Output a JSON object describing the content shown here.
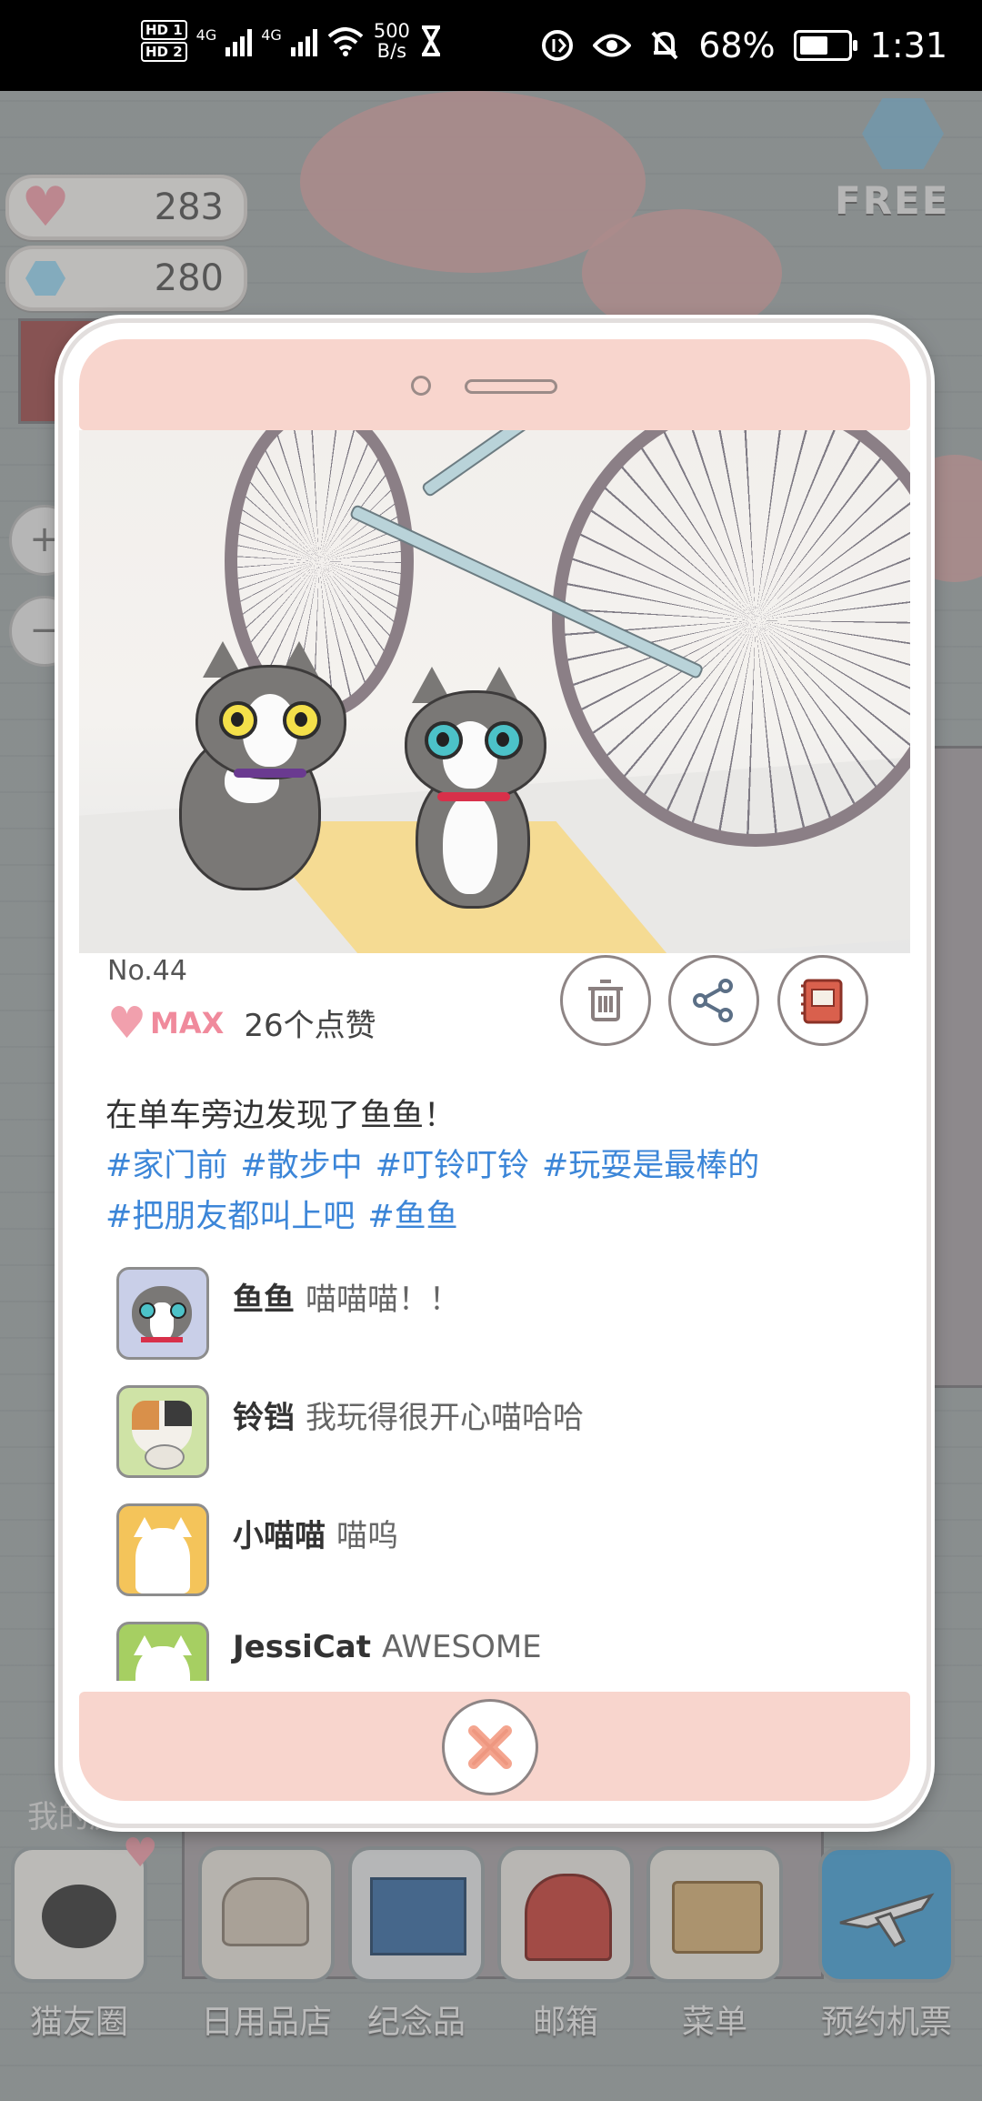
{
  "status_bar": {
    "hd1": "HD 1",
    "hd2": "HD 2",
    "net_label_1": "4G",
    "net_label_2": "4G",
    "speed_value": "500",
    "speed_unit": "B/s",
    "battery": "68%",
    "time": "1:31"
  },
  "hud": {
    "hearts": "283",
    "gems": "280",
    "free_label": "FREE"
  },
  "post": {
    "number": "No.44",
    "likes_level": "MAX",
    "likes_text": "26个点赞",
    "caption": "在单车旁边发现了鱼鱼！",
    "tags": [
      "#家门前",
      "#散步中",
      "#叮铃叮铃",
      "#玩耍是最棒的",
      "#把朋友都叫上吧",
      "#鱼鱼"
    ],
    "comments": [
      {
        "name": "鱼鱼",
        "text": "喵喵喵！！",
        "avatar": "gray-tabby-cat-avatar"
      },
      {
        "name": "铃铛",
        "text": "我玩得很开心喵哈哈",
        "avatar": "calico-cat-avatar"
      },
      {
        "name": "小喵喵",
        "text": "喵呜",
        "avatar": "white-cat-silhouette-yellow"
      },
      {
        "name": "JessiCat",
        "text": "AWESOME",
        "avatar": "white-cat-silhouette-green"
      }
    ]
  },
  "dock": {
    "items": [
      {
        "label": "猫友圈",
        "color": "#3b3b3b"
      },
      {
        "label": "日用品店",
        "color": "#d9d2c6"
      },
      {
        "label": "纪念品",
        "color": "#3c6fa7"
      },
      {
        "label": "邮箱",
        "color": "#c9443d"
      },
      {
        "label": "菜单",
        "color": "#d8b27a"
      },
      {
        "label": "预约机票",
        "color": "#4aa3d8"
      }
    ],
    "hidden_label": "我的房"
  },
  "colors": {
    "pink_panel": "#f8d5cd",
    "tag_blue": "#3c86d8",
    "heart_pink": "#f1a0ad"
  }
}
